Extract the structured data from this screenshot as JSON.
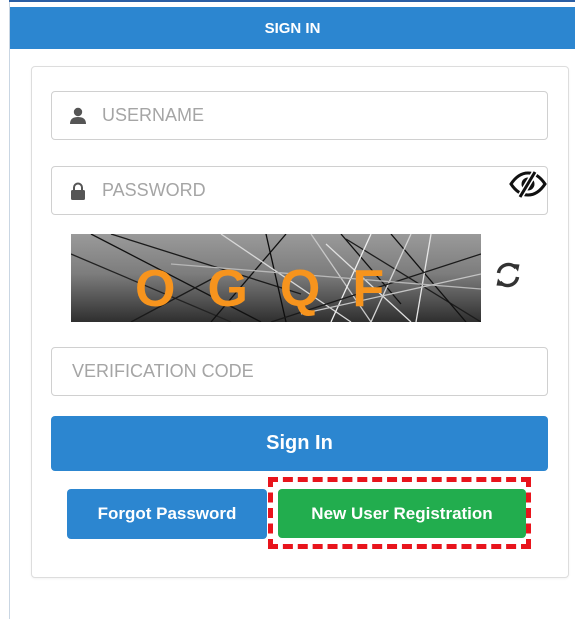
{
  "header": {
    "title": "SIGN IN"
  },
  "form": {
    "username_placeholder": "USERNAME",
    "password_placeholder": "PASSWORD",
    "verification_placeholder": "VERIFICATION CODE",
    "captcha_text": "OGQF"
  },
  "icons": {
    "username": "user-icon",
    "password": "lock-icon",
    "toggle": "eye-slash-icon",
    "refresh": "refresh-icon"
  },
  "buttons": {
    "sign_in": "Sign In",
    "forgot_password": "Forgot Password",
    "new_user_registration": "New User Registration"
  },
  "colors": {
    "primary": "#2c86d0",
    "success": "#22ad4e",
    "highlight": "#e8141c",
    "captcha_text": "#f7941d"
  }
}
